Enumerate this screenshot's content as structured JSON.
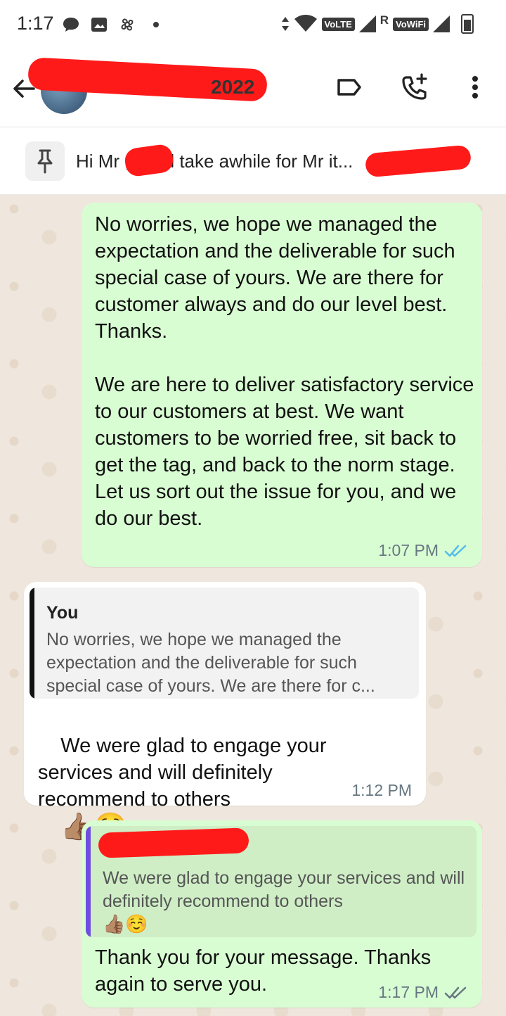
{
  "status_bar": {
    "time": "1:17",
    "volte": "VoLTE",
    "roaming": "R",
    "vowifi": "VoWiFi"
  },
  "header": {
    "contact_name_visible": "2022",
    "icons": [
      "back-arrow-icon",
      "label-icon",
      "add-call-icon",
      "more-vert-icon"
    ]
  },
  "pinned": {
    "text": "Hi Mr        , it will take awhile for Mr                 it..."
  },
  "messages": [
    {
      "direction": "outgoing",
      "text": "No worries, we hope we managed the expectation and the deliverable for such special case of yours. We are there for customer always and do our level best.  Thanks.\n\nWe are here to deliver satisfactory service to our customers at best. We want customers to be worried free, sit back to get the tag, and back to the norm stage. Let us sort out the issue for you, and we do our best.",
      "time": "1:07 PM",
      "status": "read"
    },
    {
      "direction": "incoming",
      "quote_author": "You",
      "quote_text": "No worries, we hope we managed the expectation and the deliverable for such special case of yours. We are there for c...",
      "text": "We were glad to engage your services and will definitely recommend to others",
      "emoji": "👍🏽☺️",
      "time": "1:12 PM"
    },
    {
      "direction": "outgoing",
      "quote_text": "We were glad to engage your services and will definitely recommend to others",
      "quote_emoji": "👍🏽☺️",
      "text": "Thank you for your message. Thanks again to serve you.",
      "time": "1:17 PM",
      "status": "delivered"
    }
  ],
  "colors": {
    "outgoing_bubble": "#d9fdd3",
    "incoming_bubble": "#ffffff",
    "read_ticks": "#53bdeb",
    "quote_bar_self": "#111111",
    "quote_bar_other": "#6f4de0"
  }
}
